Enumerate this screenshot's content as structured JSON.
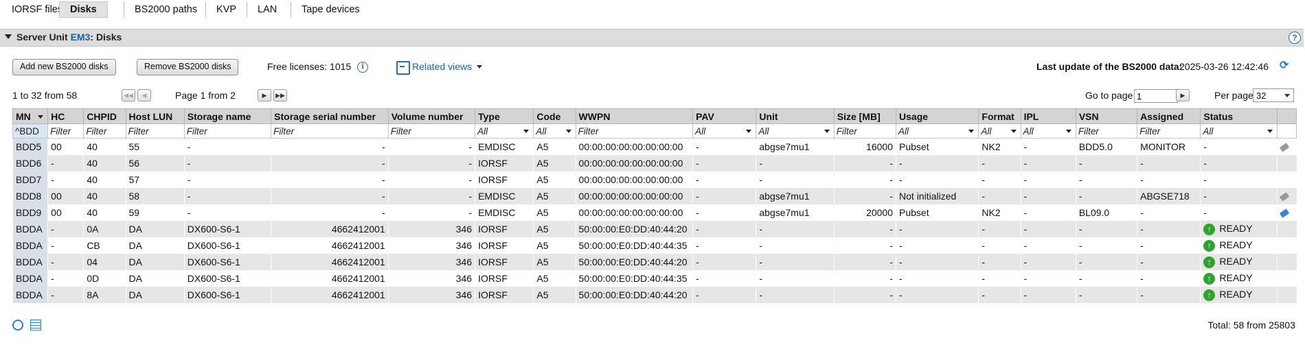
{
  "tabs": [
    "IORSF files",
    "Disks",
    "BS2000 paths",
    "KVP",
    "LAN",
    "Tape devices"
  ],
  "active_tab": "Disks",
  "panel": {
    "prefix": "Server Unit",
    "unit": "EM3",
    "suffix": ": Disks",
    "help": "?"
  },
  "toolbar": {
    "add_label": "Add new BS2000 disks",
    "remove_label": "Remove BS2000 disks",
    "licenses": "Free licenses: 1015",
    "related_views": "Related views",
    "last_update_label": "Last update of the BS2000 data:",
    "last_update_value": "2025-03-26 12:42:46"
  },
  "paging": {
    "range": "1 to 32 from 58",
    "page": "Page 1 from 2",
    "goto_label": "Go to page",
    "goto_value": "1",
    "per_page_label": "Per page",
    "per_page_value": "32"
  },
  "columns": [
    "MN",
    "HC",
    "CHPID",
    "Host LUN",
    "Storage name",
    "Storage serial number",
    "Volume number",
    "Type",
    "Code",
    "WWPN",
    "PAV",
    "Unit",
    "Size [MB]",
    "Usage",
    "Format",
    "IPL",
    "VSN",
    "Assigned",
    "Status"
  ],
  "filters": [
    "^BDD",
    "Filter",
    "Filter",
    "Filter",
    "Filter",
    "Filter",
    "Filter",
    "All",
    "All",
    "Filter",
    "All",
    "All",
    "Filter",
    "All",
    "All",
    "All",
    "Filter",
    "Filter",
    "All"
  ],
  "rows": [
    [
      "BDD5",
      "00",
      "40",
      "55",
      "-",
      "-",
      "-",
      "EMDISC",
      "A5",
      "00:00:00:00:00:00:00:00",
      "-",
      "abgse7mu1",
      "16000",
      "Pubset",
      "NK2",
      "-",
      "BDD5.0",
      "MONITOR",
      "-"
    ],
    [
      "BDD6",
      "-",
      "40",
      "56",
      "-",
      "-",
      "-",
      "IORSF",
      "A5",
      "00:00:00:00:00:00:00:00",
      "-",
      "-",
      "-",
      "-",
      "-",
      "-",
      "-",
      "-",
      "-"
    ],
    [
      "BDD7",
      "-",
      "40",
      "57",
      "-",
      "-",
      "-",
      "IORSF",
      "A5",
      "00:00:00:00:00:00:00:00",
      "-",
      "-",
      "-",
      "-",
      "-",
      "-",
      "-",
      "-",
      "-"
    ],
    [
      "BDD8",
      "00",
      "40",
      "58",
      "-",
      "-",
      "-",
      "EMDISC",
      "A5",
      "00:00:00:00:00:00:00:00",
      "-",
      "abgse7mu1",
      "-",
      "Not initialized",
      "-",
      "-",
      "-",
      "ABGSE718",
      "-"
    ],
    [
      "BDD9",
      "00",
      "40",
      "59",
      "-",
      "-",
      "-",
      "EMDISC",
      "A5",
      "00:00:00:00:00:00:00:00",
      "-",
      "abgse7mu1",
      "20000",
      "Pubset",
      "NK2",
      "-",
      "BL09.0",
      "-",
      "-"
    ],
    [
      "BDDA",
      "-",
      "0A",
      "DA",
      "DX600-S6-1",
      "4662412001",
      "346",
      "IORSF",
      "A5",
      "50:00:00:E0:DD:40:44:20",
      "-",
      "-",
      "-",
      "-",
      "-",
      "-",
      "-",
      "-",
      "READY"
    ],
    [
      "BDDA",
      "-",
      "CB",
      "DA",
      "DX600-S6-1",
      "4662412001",
      "346",
      "IORSF",
      "A5",
      "50:00:00:E0:DD:40:44:35",
      "-",
      "-",
      "-",
      "-",
      "-",
      "-",
      "-",
      "-",
      "READY"
    ],
    [
      "BDDA",
      "-",
      "04",
      "DA",
      "DX600-S6-1",
      "4662412001",
      "346",
      "IORSF",
      "A5",
      "50:00:00:E0:DD:40:44:20",
      "-",
      "-",
      "-",
      "-",
      "-",
      "-",
      "-",
      "-",
      "READY"
    ],
    [
      "BDDA",
      "-",
      "0D",
      "DA",
      "DX600-S6-1",
      "4662412001",
      "346",
      "IORSF",
      "A5",
      "50:00:00:E0:DD:40:44:35",
      "-",
      "-",
      "-",
      "-",
      "-",
      "-",
      "-",
      "-",
      "READY"
    ],
    [
      "BDDA",
      "-",
      "8A",
      "DA",
      "DX600-S6-1",
      "4662412001",
      "346",
      "IORSF",
      "A5",
      "50:00:00:E0:DD:40:44:20",
      "-",
      "-",
      "-",
      "-",
      "-",
      "-",
      "-",
      "-",
      "READY"
    ]
  ],
  "row_edit_icons": [
    "gray",
    "",
    "",
    "gray",
    "blue",
    "",
    "",
    "",
    "",
    ""
  ],
  "footer": {
    "total": "Total: 58 from 25803"
  },
  "icons": [
    "help-icon",
    "info-icon",
    "related-views-icon",
    "refresh-icon",
    "first-page-icon",
    "prev-page-icon",
    "next-page-icon",
    "last-page-icon",
    "edit-icon",
    "ready-icon",
    "history-icon",
    "table-settings-icon"
  ],
  "colors": {
    "link": "#1a5fa8",
    "header_bg": "#d4d4d4",
    "status_ok": "#2fa32f"
  }
}
